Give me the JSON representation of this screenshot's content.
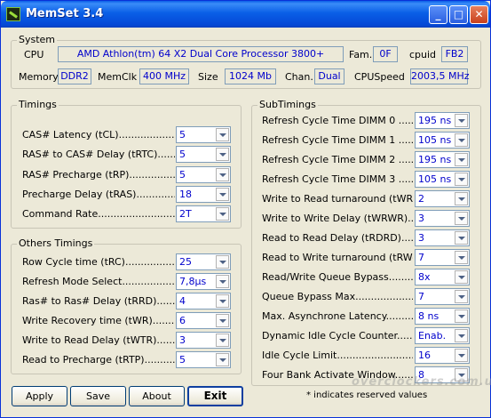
{
  "title": "MemSet 3.4",
  "window_buttons": {
    "minimize": "_",
    "maximize": "□",
    "close": "✕"
  },
  "system": {
    "label": "System",
    "cpu_label": "CPU",
    "cpu_value": "AMD Athlon(tm) 64 X2 Dual Core Processor 3800+",
    "fam_label": "Fam.",
    "fam_value": "0F",
    "cpuid_label": "cpuid",
    "cpuid_value": "FB2",
    "memory_label": "Memory",
    "memory_value": "DDR2",
    "memclk_label": "MemClk",
    "memclk_value": "400 MHz",
    "size_label": "Size",
    "size_value": "1024 Mb",
    "chan_label": "Chan.",
    "chan_value": "Dual",
    "cpuspeed_label": "CPUSpeed",
    "cpuspeed_value": "2003,5 MHz"
  },
  "timings": {
    "label": "Timings",
    "items": [
      {
        "label": "CAS# Latency (tCL)...................",
        "value": "5"
      },
      {
        "label": "RAS# to CAS# Delay (tRTC)...........",
        "value": "5"
      },
      {
        "label": "RAS# Precharge (tRP).................",
        "value": "5"
      },
      {
        "label": "Precharge Delay  (tRAS)...............",
        "value": "18"
      },
      {
        "label": "Command Rate.........................",
        "value": "2T"
      }
    ]
  },
  "others": {
    "label": "Others Timings",
    "items": [
      {
        "label": "Row Cycle time (tRC)..................",
        "value": "25"
      },
      {
        "label": "Refresh Mode Select...................",
        "value": "7,8µs"
      },
      {
        "label": "Ras# to Ras# Delay (tRRD).............",
        "value": "4"
      },
      {
        "label": "Write Recovery time (tWR)..............",
        "value": "6"
      },
      {
        "label": "Write to Read Delay (tWTR).............",
        "value": "3"
      },
      {
        "label": "Read to Precharge (tRTP)...............",
        "value": "5"
      }
    ]
  },
  "subtimings": {
    "label": "SubTimings",
    "items": [
      {
        "label": "Refresh Cycle Time  DIMM 0 ..........",
        "value": "195 ns"
      },
      {
        "label": "Refresh Cycle Time  DIMM 1 ..........",
        "value": "105 ns"
      },
      {
        "label": "Refresh Cycle Time  DIMM 2 ..........",
        "value": "195 ns"
      },
      {
        "label": "Refresh Cycle Time  DIMM 3 ..........",
        "value": "105 ns"
      },
      {
        "label": "Write to Read turnaround (tWRRD)........",
        "value": "2"
      },
      {
        "label": "Write to Write Delay (tWRWR)..............",
        "value": "3"
      },
      {
        "label": "Read to Read Delay (tRDRD).................",
        "value": "3"
      },
      {
        "label": "Read to Write turnaround (tRW-TO)..........",
        "value": "7"
      },
      {
        "label": "Read/Write Queue Bypass.....................",
        "value": "8x"
      },
      {
        "label": "Queue Bypass Max...............................",
        "value": "7"
      },
      {
        "label": "Max. Asynchrone Latency...................",
        "value": "8 ns"
      },
      {
        "label": "Dynamic Idle Cycle Counter.................",
        "value": "Enab."
      },
      {
        "label": "Idle Cycle Limit...................................",
        "value": "16"
      },
      {
        "label": "Four Bank Activate Window..................",
        "value": "8"
      }
    ]
  },
  "buttons": {
    "apply": "Apply",
    "save": "Save",
    "about": "About",
    "exit": "Exit"
  },
  "note": "* indicates reserved values",
  "watermark": "overclockers.com.ua"
}
